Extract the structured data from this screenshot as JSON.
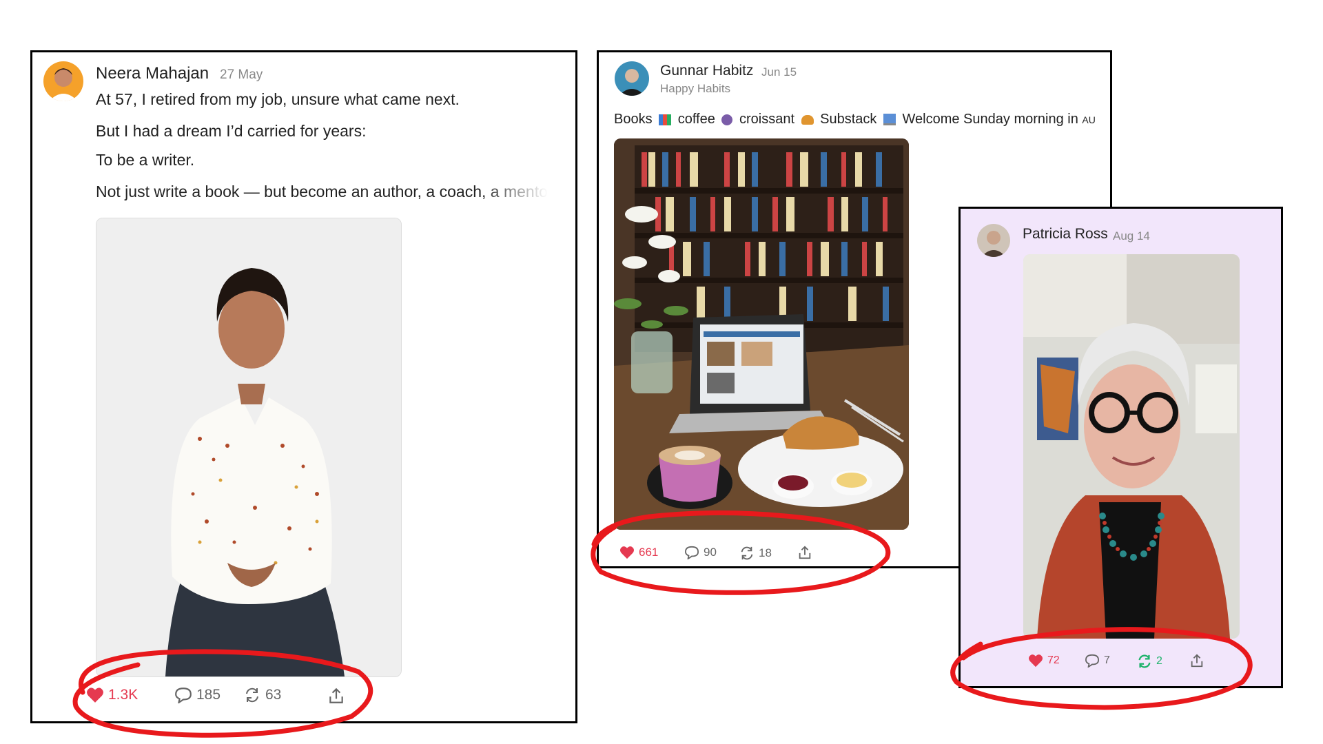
{
  "post1": {
    "author": "Neera Mahajan",
    "date": "27 May",
    "lines": [
      "At 57, I retired from my job, unsure what came next.",
      "But I had a dream I’d carried for years:",
      "To be a writer.",
      "Not just write a book — but become an author, a coach, a mento"
    ],
    "likes": "1.3K",
    "comments": "185",
    "restacks": "63"
  },
  "post2": {
    "author": "Gunnar Habitz",
    "date": "Jun 15",
    "publication": "Happy Habits",
    "text_parts": [
      "Books",
      "coffee",
      "croissant",
      "Substack",
      "Welcome Sunday morning in"
    ],
    "text_tail": "AU",
    "likes": "661",
    "comments": "90",
    "restacks": "18"
  },
  "post3": {
    "author": "Patricia Ross",
    "date": "Aug 14",
    "likes": "72",
    "comments": "7",
    "restacks": "2"
  },
  "colors": {
    "like": "#e53950",
    "restack_active": "#1fb36b",
    "annotation": "#e8191c",
    "post3_bg": "#f2e6fb"
  },
  "icons": [
    "heart-icon",
    "comment-icon",
    "restack-icon",
    "share-icon"
  ]
}
